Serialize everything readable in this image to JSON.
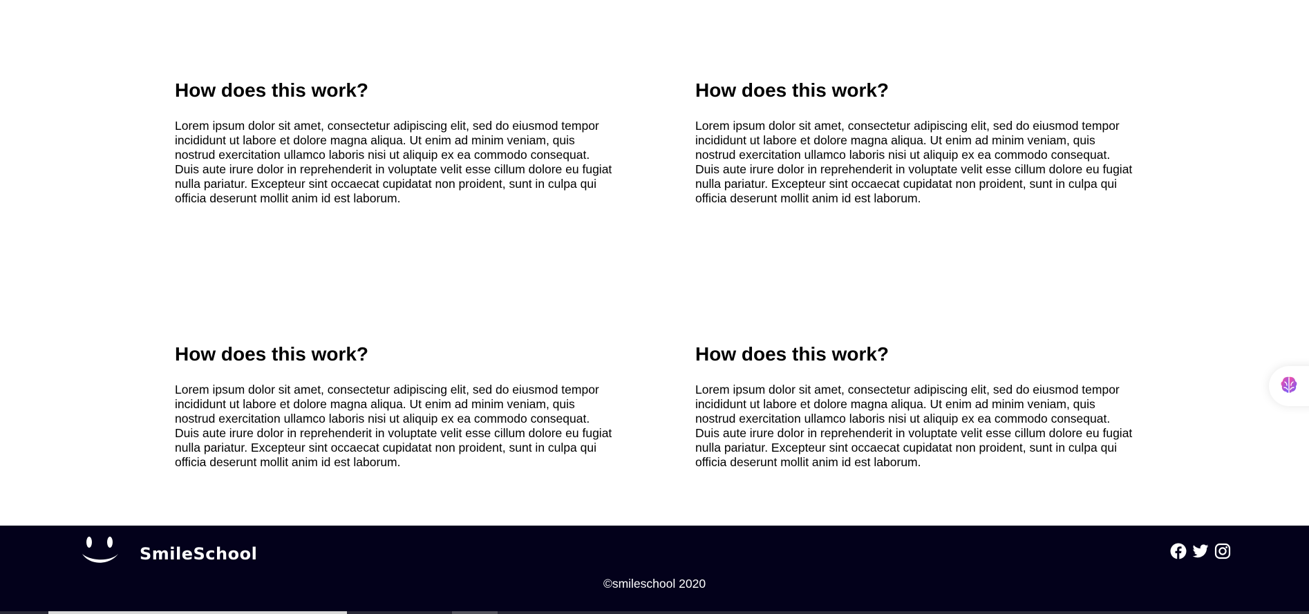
{
  "faq": [
    {
      "title": "How does this work?",
      "body": "Lorem ipsum dolor sit amet, consectetur adipiscing elit, sed do eiusmod tempor incididunt ut labore et dolore magna aliqua. Ut enim ad minim veniam, quis nostrud exercitation ullamco laboris nisi ut aliquip ex ea commodo consequat. Duis aute irure dolor in reprehenderit in voluptate velit esse cillum dolore eu fugiat nulla pariatur. Excepteur sint occaecat cupidatat non proident, sunt in culpa qui officia deserunt mollit anim id est laborum."
    },
    {
      "title": "How does this work?",
      "body": "Lorem ipsum dolor sit amet, consectetur adipiscing elit, sed do eiusmod tempor incididunt ut labore et dolore magna aliqua. Ut enim ad minim veniam, quis nostrud exercitation ullamco laboris nisi ut aliquip ex ea commodo consequat. Duis aute irure dolor in reprehenderit in voluptate velit esse cillum dolore eu fugiat nulla pariatur. Excepteur sint occaecat cupidatat non proident, sunt in culpa qui officia deserunt mollit anim id est laborum."
    },
    {
      "title": "How does this work?",
      "body": "Lorem ipsum dolor sit amet, consectetur adipiscing elit, sed do eiusmod tempor incididunt ut labore et dolore magna aliqua. Ut enim ad minim veniam, quis nostrud exercitation ullamco laboris nisi ut aliquip ex ea commodo consequat. Duis aute irure dolor in reprehenderit in voluptate velit esse cillum dolore eu fugiat nulla pariatur. Excepteur sint occaecat cupidatat non proident, sunt in culpa qui officia deserunt mollit anim id est laborum."
    },
    {
      "title": "How does this work?",
      "body": "Lorem ipsum dolor sit amet, consectetur adipiscing elit, sed do eiusmod tempor incididunt ut labore et dolore magna aliqua. Ut enim ad minim veniam, quis nostrud exercitation ullamco laboris nisi ut aliquip ex ea commodo consequat. Duis aute irure dolor in reprehenderit in voluptate velit esse cillum dolore eu fugiat nulla pariatur. Excepteur sint occaecat cupidatat non proident, sunt in culpa qui officia deserunt mollit anim id est laborum."
    }
  ],
  "footer": {
    "brand": "SmileSchool",
    "copyright": "©smileschool 2020",
    "social_icons": [
      "facebook-icon",
      "twitter-icon",
      "instagram-icon"
    ],
    "background_color": "#03011b"
  },
  "floating_widget": {
    "icon": "brain-icon"
  }
}
